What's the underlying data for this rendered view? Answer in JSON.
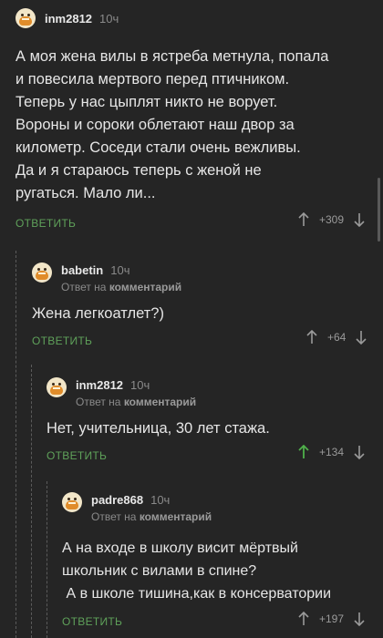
{
  "comments": [
    {
      "nick": "inm2812",
      "time": "10ч",
      "reply_to_prefix": "",
      "reply_to_strong": "",
      "text": "А моя жена вилы в ястреба метнула, попала\nи повесила мертвого перед птичником.\nТеперь у нас цыплят никто не ворует.\nВороны и сороки облетают наш двор за\nкилометр. Соседи стали очень вежливы.\nДа и я стараюсь теперь с женой не\nругаться. Мало ли...",
      "reply_label": "ОТВЕТИТЬ",
      "rating": "+309"
    },
    {
      "nick": "babetin",
      "time": "10ч",
      "reply_to_prefix": "Ответ на ",
      "reply_to_strong": "комментарий",
      "text": "Жена легкоатлет?)",
      "reply_label": "ОТВЕТИТЬ",
      "rating": "+64"
    },
    {
      "nick": "inm2812",
      "time": "10ч",
      "reply_to_prefix": "Ответ на ",
      "reply_to_strong": "комментарий",
      "text": "Нет, учительница, 30 лет стажа.",
      "reply_label": "ОТВЕТИТЬ",
      "rating": "+134"
    },
    {
      "nick": "padre868",
      "time": "10ч",
      "reply_to_prefix": "Ответ на ",
      "reply_to_strong": "комментарий",
      "text": "А на входе в школу висит мёртвый\nшкольник с вилами в спине?\n А в школе тишина,как в консерватории",
      "reply_label": "ОТВЕТИТЬ",
      "rating": "+197"
    }
  ],
  "colors": {
    "background": "#252525",
    "reply_green": "#5fa15a",
    "upvoted_green": "#4fb04a",
    "muted": "#8a8a8a"
  },
  "icons": [
    "avatar-cat",
    "arrow-up-icon",
    "arrow-down-icon"
  ]
}
